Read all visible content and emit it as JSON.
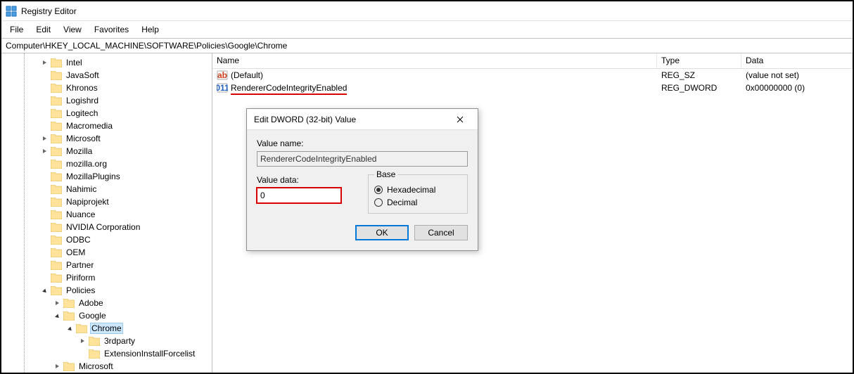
{
  "window_title": "Registry Editor",
  "menubar": [
    "File",
    "Edit",
    "View",
    "Favorites",
    "Help"
  ],
  "address": "Computer\\HKEY_LOCAL_MACHINE\\SOFTWARE\\Policies\\Google\\Chrome",
  "tree": [
    {
      "indent": 3,
      "exp": "collapsed",
      "label": "Intel"
    },
    {
      "indent": 3,
      "exp": "none",
      "label": "JavaSoft"
    },
    {
      "indent": 3,
      "exp": "none",
      "label": "Khronos"
    },
    {
      "indent": 3,
      "exp": "none",
      "label": "Logishrd"
    },
    {
      "indent": 3,
      "exp": "none",
      "label": "Logitech"
    },
    {
      "indent": 3,
      "exp": "none",
      "label": "Macromedia"
    },
    {
      "indent": 3,
      "exp": "collapsed",
      "label": "Microsoft"
    },
    {
      "indent": 3,
      "exp": "collapsed",
      "label": "Mozilla"
    },
    {
      "indent": 3,
      "exp": "none",
      "label": "mozilla.org"
    },
    {
      "indent": 3,
      "exp": "none",
      "label": "MozillaPlugins"
    },
    {
      "indent": 3,
      "exp": "none",
      "label": "Nahimic"
    },
    {
      "indent": 3,
      "exp": "none",
      "label": "Napiprojekt"
    },
    {
      "indent": 3,
      "exp": "none",
      "label": "Nuance"
    },
    {
      "indent": 3,
      "exp": "none",
      "label": "NVIDIA Corporation"
    },
    {
      "indent": 3,
      "exp": "none",
      "label": "ODBC"
    },
    {
      "indent": 3,
      "exp": "none",
      "label": "OEM"
    },
    {
      "indent": 3,
      "exp": "none",
      "label": "Partner"
    },
    {
      "indent": 3,
      "exp": "none",
      "label": "Piriform"
    },
    {
      "indent": 3,
      "exp": "expanded",
      "label": "Policies"
    },
    {
      "indent": 4,
      "exp": "collapsed",
      "label": "Adobe"
    },
    {
      "indent": 4,
      "exp": "expanded",
      "label": "Google"
    },
    {
      "indent": 5,
      "exp": "expanded",
      "label": "Chrome",
      "selected": true
    },
    {
      "indent": 6,
      "exp": "collapsed",
      "label": "3rdparty"
    },
    {
      "indent": 6,
      "exp": "none",
      "label": "ExtensionInstallForcelist"
    },
    {
      "indent": 4,
      "exp": "collapsed",
      "label": "Microsoft"
    }
  ],
  "columns": {
    "name": "Name",
    "type": "Type",
    "data": "Data"
  },
  "values": [
    {
      "icon": "string",
      "name": "(Default)",
      "type": "REG_SZ",
      "data": "(value not set)"
    },
    {
      "icon": "binary",
      "name": "RendererCodeIntegrityEnabled",
      "type": "REG_DWORD",
      "data": "0x00000000 (0)",
      "underline": true
    }
  ],
  "dialog": {
    "title": "Edit DWORD (32-bit) Value",
    "value_name_label": "Value name:",
    "value_name": "RendererCodeIntegrityEnabled",
    "value_data_label": "Value data:",
    "value_data": "0",
    "base_label": "Base",
    "hex_label": "Hexadecimal",
    "dec_label": "Decimal",
    "ok": "OK",
    "cancel": "Cancel"
  }
}
